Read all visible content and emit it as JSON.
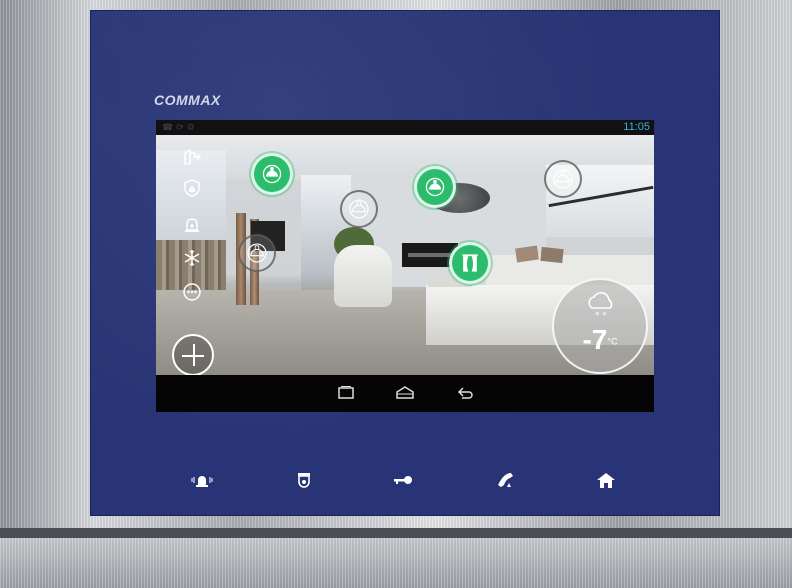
{
  "brand": "COMMAX",
  "status_bar": {
    "time": "11:05",
    "icons": [
      "phone-icon",
      "sync-icon",
      "settings-icon"
    ]
  },
  "sidebar": {
    "items": [
      {
        "name": "exit-door-icon"
      },
      {
        "name": "security-shield-icon"
      },
      {
        "name": "alarm-siren-icon"
      },
      {
        "name": "snowflake-icon"
      },
      {
        "name": "more-icon"
      }
    ],
    "add_button": "add-icon"
  },
  "devices": [
    {
      "name": "ceiling-light-left",
      "icon": "bulb-icon",
      "state": "on"
    },
    {
      "name": "ceiling-light-center",
      "icon": "bulb-icon",
      "state": "on"
    },
    {
      "name": "light-wall",
      "icon": "bulb-icon",
      "state": "off"
    },
    {
      "name": "light-living",
      "icon": "bulb-icon",
      "state": "off"
    },
    {
      "name": "light-window",
      "icon": "bulb-icon",
      "state": "off"
    },
    {
      "name": "curtain",
      "icon": "curtain-icon",
      "state": "on"
    }
  ],
  "weather": {
    "temperature": "-7",
    "unit": "°C",
    "icon": "snow-cloud-icon"
  },
  "nav_bar": [
    "recent-apps-icon",
    "home-icon",
    "back-icon"
  ],
  "hardware_buttons": [
    "alarm-icon",
    "camera-monitor-icon",
    "door-key-icon",
    "call-icon",
    "home-icon"
  ],
  "colors": {
    "panel": "#253275",
    "device_on": "#2bbd6d",
    "time": "#33b5e5"
  }
}
